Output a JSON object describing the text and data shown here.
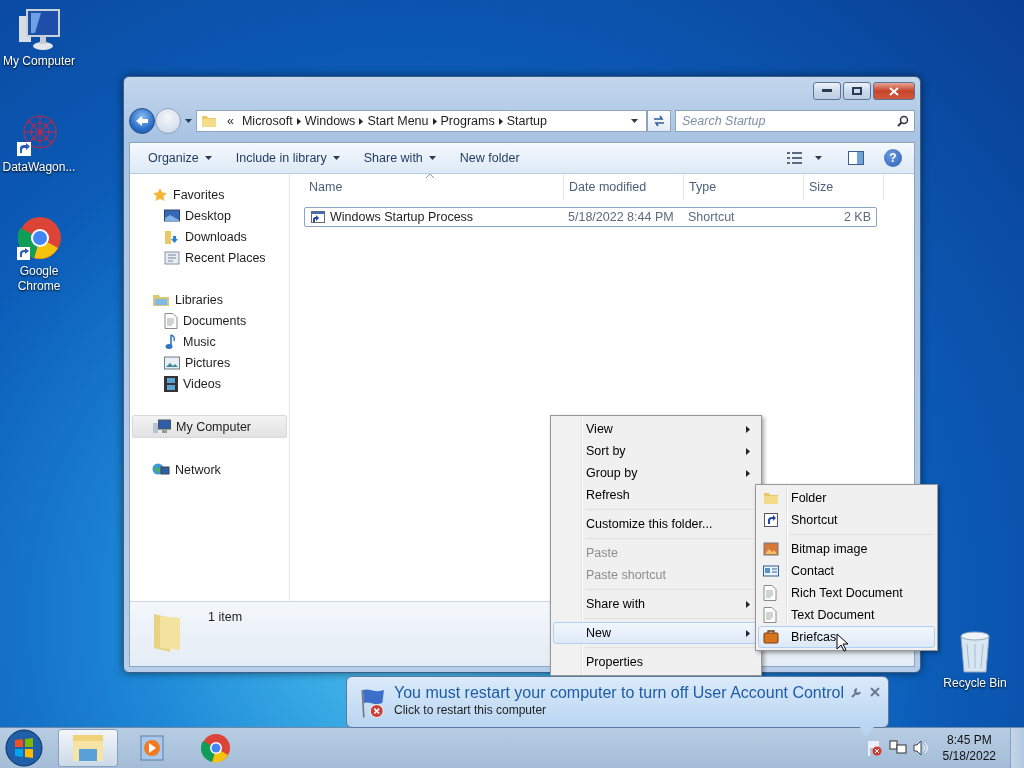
{
  "desktop_icons": [
    {
      "label": "My Computer",
      "kind": "computer"
    },
    {
      "label": "DataWagon...",
      "kind": "datawagon"
    },
    {
      "label": "Google Chrome",
      "kind": "chrome"
    }
  ],
  "recycle_bin": {
    "label": "Recycle Bin"
  },
  "window": {
    "address": {
      "overflow": "«",
      "crumbs": [
        "Microsoft",
        "Windows",
        "Start Menu",
        "Programs",
        "Startup"
      ]
    },
    "search": {
      "placeholder": "Search Startup"
    },
    "commands": [
      {
        "label": "Organize",
        "menu": true
      },
      {
        "label": "Include in library",
        "menu": true
      },
      {
        "label": "Share with",
        "menu": true
      },
      {
        "label": "New folder",
        "menu": false
      }
    ],
    "nav": [
      {
        "label": "Favorites",
        "kind": "star",
        "selected": false,
        "children": [
          {
            "label": "Desktop",
            "kind": "desktop",
            "selected": false
          },
          {
            "label": "Downloads",
            "kind": "downloads",
            "selected": false
          },
          {
            "label": "Recent Places",
            "kind": "recent",
            "selected": false
          }
        ]
      },
      {
        "label": "Libraries",
        "kind": "libraries",
        "selected": false,
        "children": [
          {
            "label": "Documents",
            "kind": "documents",
            "selected": false
          },
          {
            "label": "Music",
            "kind": "music",
            "selected": false
          },
          {
            "label": "Pictures",
            "kind": "pictures",
            "selected": false
          },
          {
            "label": "Videos",
            "kind": "videos",
            "selected": false
          }
        ]
      },
      {
        "label": "My Computer",
        "kind": "computer",
        "selected": true
      },
      {
        "label": "Network",
        "kind": "network",
        "selected": false
      }
    ],
    "help": "?",
    "columns": [
      "Name",
      "Date modified",
      "Type",
      "Size"
    ],
    "rows": [
      {
        "name": "Windows Startup Process",
        "date": "5/18/2022 8:44 PM",
        "type": "Shortcut",
        "size": "2 KB",
        "selected": true
      }
    ],
    "details": {
      "count": "1 item"
    }
  },
  "context_menu": {
    "groups": [
      [
        {
          "label": "View",
          "submenu": true,
          "disabled": false,
          "selected": false
        },
        {
          "label": "Sort by",
          "submenu": true,
          "disabled": false,
          "selected": false
        },
        {
          "label": "Group by",
          "submenu": true,
          "disabled": false,
          "selected": false
        },
        {
          "label": "Refresh",
          "submenu": false,
          "disabled": false,
          "selected": false
        }
      ],
      [
        {
          "label": "Customize this folder...",
          "submenu": false,
          "disabled": false,
          "selected": false
        }
      ],
      [
        {
          "label": "Paste",
          "submenu": false,
          "disabled": true,
          "selected": false
        },
        {
          "label": "Paste shortcut",
          "submenu": false,
          "disabled": true,
          "selected": false
        }
      ],
      [
        {
          "label": "Share with",
          "submenu": true,
          "disabled": false,
          "selected": false
        }
      ],
      [
        {
          "label": "New",
          "submenu": true,
          "disabled": false,
          "selected": true
        }
      ],
      [
        {
          "label": "Properties",
          "submenu": false,
          "disabled": false,
          "selected": false
        }
      ]
    ]
  },
  "new_submenu": {
    "groups": [
      [
        {
          "label": "Folder",
          "kind": "folder",
          "selected": false
        },
        {
          "label": "Shortcut",
          "kind": "shortcut",
          "selected": false
        }
      ],
      [
        {
          "label": "Bitmap image",
          "kind": "bitmap",
          "selected": false
        },
        {
          "label": "Contact",
          "kind": "contact",
          "selected": false
        },
        {
          "label": "Rich Text Document",
          "kind": "richtext",
          "selected": false
        },
        {
          "label": "Text Document",
          "kind": "text",
          "selected": false
        },
        {
          "label": "Briefcas",
          "kind": "briefcase",
          "selected": true
        }
      ]
    ]
  },
  "notification": {
    "title": "You must restart your computer to turn off User Account Control",
    "subtitle": "Click to restart this computer"
  },
  "taskbar": {
    "buttons": [
      {
        "kind": "explorer",
        "selected": true
      },
      {
        "kind": "media",
        "selected": false
      },
      {
        "kind": "chrome",
        "selected": false
      }
    ],
    "time": "8:45 PM",
    "date": "5/18/2022"
  }
}
